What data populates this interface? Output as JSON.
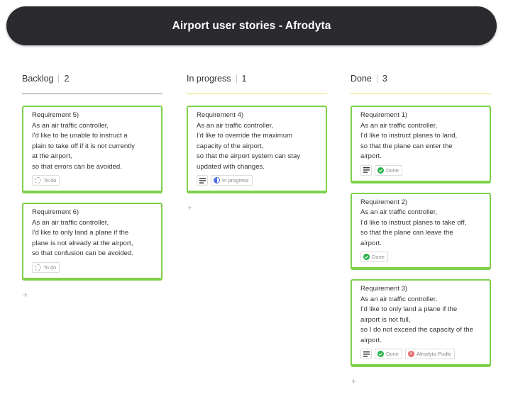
{
  "header": {
    "title": "Airport user stories - Afrodyta"
  },
  "columns": [
    {
      "name": "Backlog",
      "count": "2",
      "line_color": "#8a8a8a",
      "cards": [
        {
          "title": "Requirement 5)",
          "text": "As an air traffic controller,\nI'd like to be unable to instruct a\nplain to take off if it is not currently\nat the airport,\nso that errors can be avoided.",
          "status": "To do"
        },
        {
          "title": "Requirement 6)",
          "text": "As an air traffic controller,\nI'd like to only land a plane if the\nplane is not already at the airport,\nso that confusion can be avoided.",
          "status": "To do"
        }
      ]
    },
    {
      "name": "In progress",
      "count": "1",
      "line_color": "#e6e05a",
      "cards": [
        {
          "title": "Requirement 4)",
          "text": "As an air traffic controller,\nI'd like to override the maximum\ncapacity of the airport,\nso that the airport system can stay\nupdated with changes.",
          "status": "In progress"
        }
      ]
    },
    {
      "name": "Done",
      "count": "3",
      "line_color": "#e6e05a",
      "cards": [
        {
          "title": "Requirement 1)",
          "text": "As an air traffic controller,\nI'd like to instruct planes to land,\nso that the plane can enter the\nairport.",
          "status": "Done"
        },
        {
          "title": "Requirement 2)",
          "text": "As an air traffic controller,\nI'd like to instruct planes to take off,\nso that the plane can leave the\nairport.",
          "status": "Done"
        },
        {
          "title": "Requirement 3)",
          "text": "As an air traffic controller,\nI'd like to only land a plane if the\nairport is not full,\nso I do not exceed the capacity of the\nairport.",
          "status": "Done",
          "assignee": "Afrodyta Pudło",
          "assignee_initial": "A"
        }
      ]
    }
  ],
  "add_symbol": "+",
  "colors": {
    "card_border": "#7ed04a",
    "done": "#27b34a",
    "in_progress": "#4b6ed8",
    "header_bg": "#2b2b2f"
  }
}
